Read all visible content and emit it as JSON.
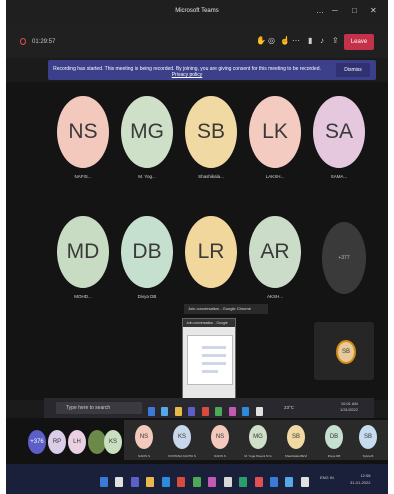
{
  "window": {
    "title": "Microsoft Teams",
    "controls": [
      "…",
      "─",
      "□",
      "✕"
    ]
  },
  "toolbar": {
    "timer": "01:29:57",
    "leave_label": "Leave",
    "icons": [
      "people-icon",
      "chat-icon",
      "raise-hand-icon",
      "more-icon",
      "camera-icon",
      "mic-icon",
      "share-icon"
    ]
  },
  "banner": {
    "text": "Recording has started. This meeting is being recorded. By joining, you are giving consent for this meeting to be recorded.",
    "link": "Privacy policy",
    "dismiss_label": "Dismiss"
  },
  "participants": [
    {
      "initials": "NS",
      "name": "NAFIS...",
      "color": "#f3c9bd"
    },
    {
      "initials": "MG",
      "name": "M. Yog...",
      "color": "#cfe0c8"
    },
    {
      "initials": "SB",
      "name": "Shashikala...",
      "color": "#f1d9a4"
    },
    {
      "initials": "LK",
      "name": "LAKSH...",
      "color": "#f4cbc0"
    },
    {
      "initials": "SA",
      "name": "SAMA...",
      "color": "#e5c8de"
    },
    {
      "initials": "MD",
      "name": "MOHD...",
      "color": "#c7dcc2"
    },
    {
      "initials": "DB",
      "name": "Divya DB",
      "color": "#c6e0cf"
    },
    {
      "initials": "LR",
      "name": "",
      "color": "#f2d79c"
    },
    {
      "initials": "AR",
      "name": "AKSH...",
      "color": "#cbdcc8"
    }
  ],
  "more_label": "+377",
  "chrome_popup": {
    "tooltip": "Join conversation - Google Chrome",
    "preview_title": "Join conversation - Google Ch..."
  },
  "self_view": {
    "initials": "SB",
    "ring_color": "#d08d14"
  },
  "taskbar_top": {
    "search_placeholder": "Type here to search",
    "weather": "23°C",
    "time": "10:01 AM",
    "date": "1/31/2022"
  },
  "strip": {
    "mini_avatars": [
      {
        "initials": "+376",
        "color": "#5b5fc7"
      },
      {
        "initials": "RP",
        "color": "#d9cde8"
      },
      {
        "initials": "LH",
        "color": "#e9d0e2"
      },
      {
        "initials": "",
        "color": "#6b8a4a"
      },
      {
        "initials": "KS",
        "color": "#c8e0c0"
      }
    ],
    "tiles": [
      {
        "initials": "NS",
        "label": "NAFIS S",
        "color": "#f3c9bd"
      },
      {
        "initials": "KS",
        "label": "KOSTANA KAVITA S",
        "color": "#c8d8ea"
      },
      {
        "initials": "NS",
        "label": "NAFIS S",
        "color": "#f3c9bd"
      },
      {
        "initials": "MG",
        "label": "M. Yoga Pavani M G",
        "color": "#cfe0c8"
      },
      {
        "initials": "SB",
        "label": "Shashikala BEVI",
        "color": "#f1d9a4"
      },
      {
        "initials": "DB",
        "label": "Divya DB",
        "color": "#c6e0cf"
      },
      {
        "initials": "SB",
        "label": "Sylvia B",
        "color": "#c8dcef"
      }
    ]
  },
  "taskbar_bottom": {
    "lang": "ENG IN",
    "time": "12:08",
    "date": "31-01-2022"
  }
}
